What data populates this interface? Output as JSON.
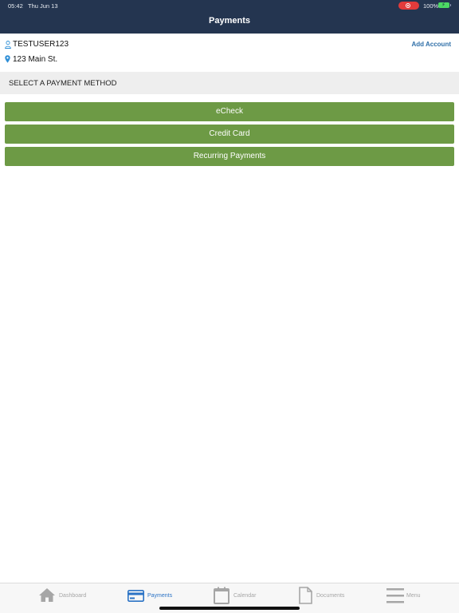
{
  "status_bar": {
    "time": "05:42",
    "date": "Thu Jun 13",
    "battery_percent": "100%",
    "recording_indicator": "screen-record-icon",
    "battery_icon": "battery-charging-icon"
  },
  "header": {
    "title": "Payments",
    "background_color": "#243550"
  },
  "account": {
    "username": "TESTUSER123",
    "address": "123 Main St.",
    "add_account_label": "Add Account",
    "user_icon": "user-icon",
    "location_icon": "map-pin-icon"
  },
  "section": {
    "title": "SELECT A PAYMENT METHOD"
  },
  "payment_methods": [
    {
      "label": "eCheck"
    },
    {
      "label": "Credit Card"
    },
    {
      "label": "Recurring Payments"
    }
  ],
  "colors": {
    "accent_green": "#6d9a45",
    "link_blue": "#2f6fa8",
    "active_tab_blue": "#2b73c5",
    "inactive_tab_gray": "#a6a6a6"
  },
  "tab_bar": {
    "tabs": [
      {
        "label": "Dashboard",
        "icon": "home-icon",
        "active": false
      },
      {
        "label": "Payments",
        "icon": "credit-card-icon",
        "active": true
      },
      {
        "label": "Calendar",
        "icon": "calendar-icon",
        "active": false
      },
      {
        "label": "Documents",
        "icon": "document-icon",
        "active": false
      },
      {
        "label": "Menu",
        "icon": "menu-icon",
        "active": false
      }
    ]
  }
}
